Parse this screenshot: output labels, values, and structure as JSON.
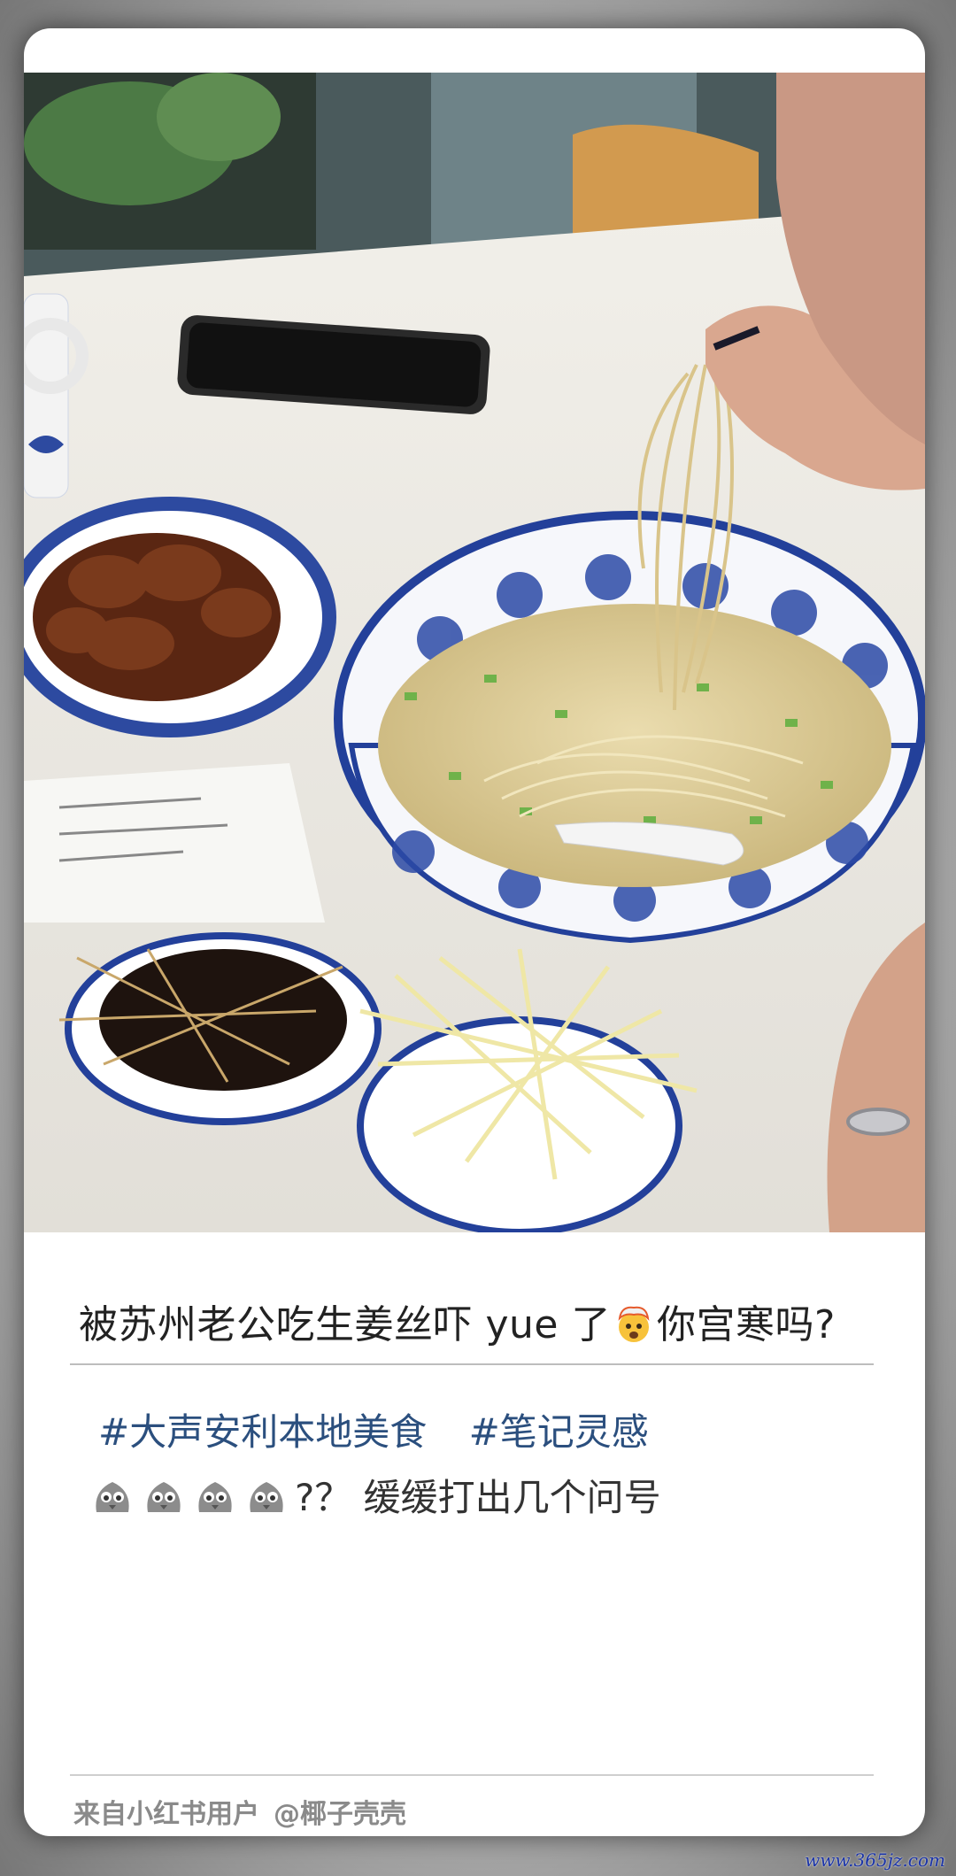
{
  "post": {
    "title_before": "被苏州老公吃生姜丝吓 yue 了",
    "title_emoji": "exploding-head-emoji",
    "title_after": "你宫寒吗?",
    "tags": [
      "#大声安利本地美食",
      "#笔记灵感"
    ],
    "body_emoji": "chick-face-emoji",
    "body_emoji_count": 4,
    "body_text": "?？ 缓缓打出几个问号"
  },
  "footer": {
    "source": "来自小红书用户",
    "handle": "@椰子壳壳"
  },
  "watermark": "www.365jz.com",
  "colors": {
    "tag": "#2b4f7e",
    "title": "#222222",
    "footer": "#8a8a8a",
    "watermark": "#1a33a8"
  }
}
